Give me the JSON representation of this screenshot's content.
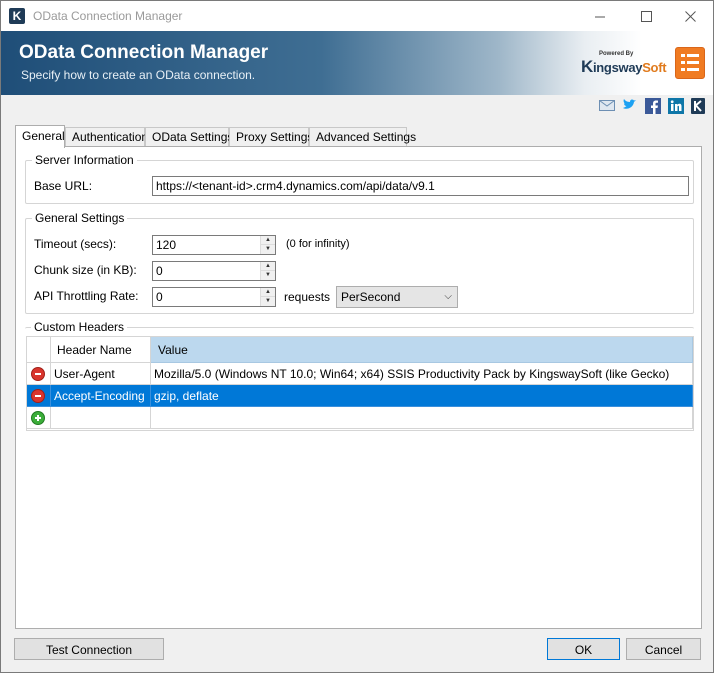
{
  "window": {
    "title": "OData Connection Manager",
    "icon_letter": "K"
  },
  "banner": {
    "title": "OData Connection Manager",
    "subtitle": "Specify how to create an OData connection.",
    "brand_powered": "Powered By",
    "brand_k": "K",
    "brand_ingsway": "ingsway",
    "brand_soft": "Soft"
  },
  "social_icons": [
    "email-icon",
    "twitter-icon",
    "facebook-icon",
    "linkedin-icon",
    "kingsway-icon"
  ],
  "tabs": [
    {
      "label": "General",
      "active": true
    },
    {
      "label": "Authentication",
      "active": false
    },
    {
      "label": "OData Settings",
      "active": false
    },
    {
      "label": "Proxy Settings",
      "active": false
    },
    {
      "label": "Advanced Settings",
      "active": false
    }
  ],
  "server_info": {
    "legend": "Server Information",
    "base_url_label": "Base URL:",
    "base_url_value": "https://<tenant-id>.crm4.dynamics.com/api/data/v9.1"
  },
  "general_settings": {
    "legend": "General Settings",
    "timeout_label": "Timeout (secs):",
    "timeout_value": "120",
    "timeout_hint": "(0 for infinity)",
    "chunk_label": "Chunk size (in KB):",
    "chunk_value": "0",
    "throttle_label": "API Throttling Rate:",
    "throttle_value": "0",
    "throttle_unit": "requests",
    "throttle_period": "PerSecond"
  },
  "custom_headers": {
    "legend": "Custom Headers",
    "columns": [
      "Header Name",
      "Value"
    ],
    "rows": [
      {
        "name": "User-Agent",
        "value": "Mozilla/5.0 (Windows NT 10.0; Win64; x64) SSIS Productivity Pack by KingswaySoft (like Gecko)",
        "selected": false
      },
      {
        "name": "Accept-Encoding",
        "value": "gzip, deflate",
        "selected": true
      }
    ]
  },
  "buttons": {
    "test": "Test Connection",
    "ok": "OK",
    "cancel": "Cancel"
  },
  "colors": {
    "accent": "#0078d7",
    "banner_dark": "#1f4e78",
    "brand_orange": "#f07b22"
  }
}
